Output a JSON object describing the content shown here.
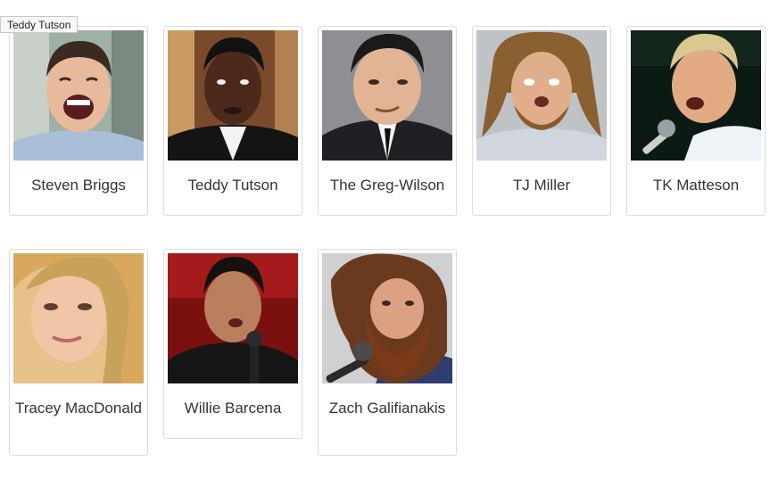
{
  "tooltip": "Teddy Tutson",
  "comedians": [
    {
      "name": "Steven Briggs"
    },
    {
      "name": "Teddy Tutson"
    },
    {
      "name": "The Greg-Wilson"
    },
    {
      "name": "TJ Miller"
    },
    {
      "name": "TK Matteson"
    },
    {
      "name": "Tracey MacDonald"
    },
    {
      "name": "Willie Barcena"
    },
    {
      "name": "Zach Galifianakis"
    }
  ]
}
